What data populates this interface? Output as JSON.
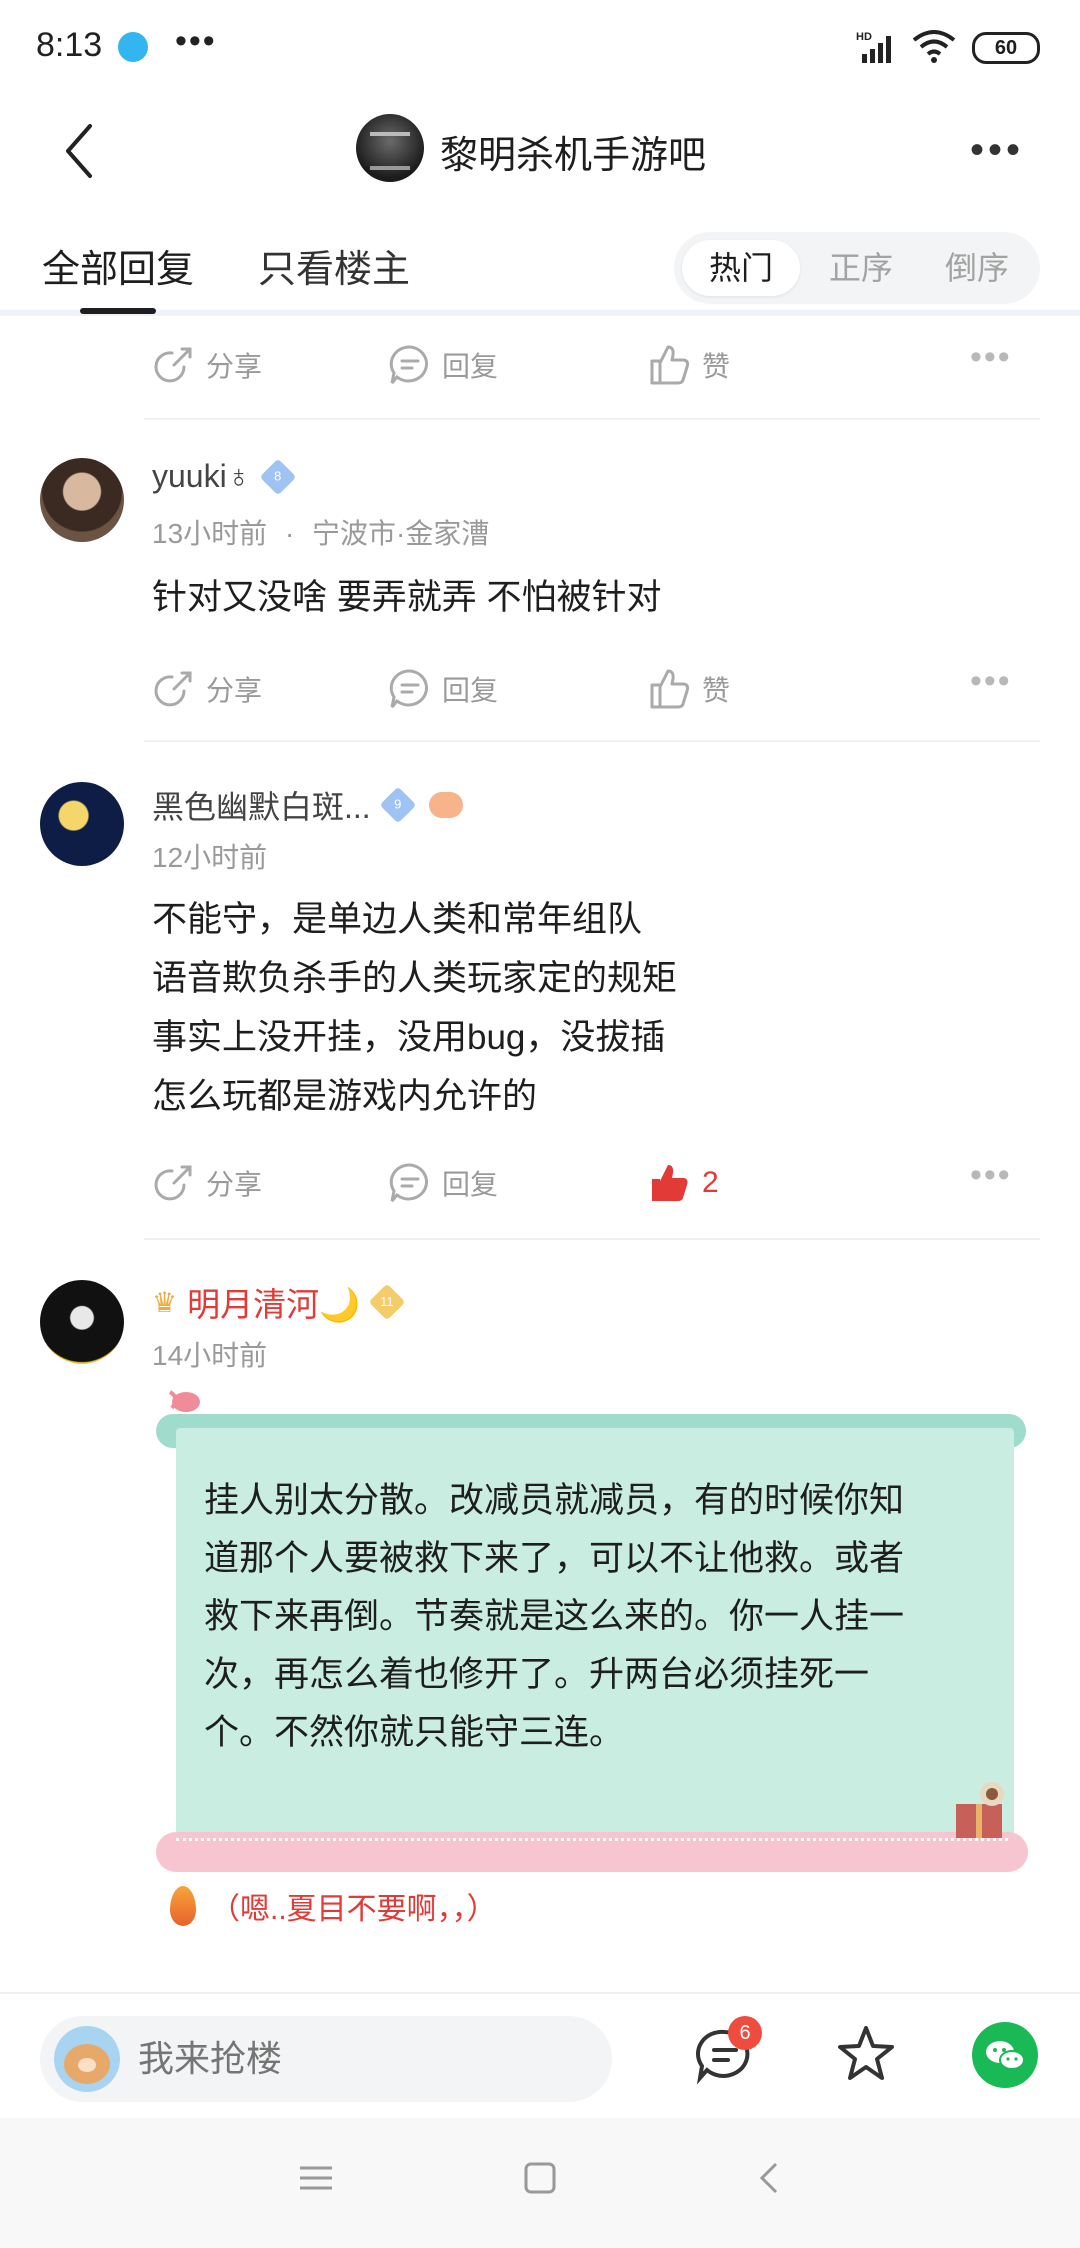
{
  "status_bar": {
    "time": "8:13",
    "hd_label": "HD",
    "battery": "60",
    "icons": [
      "app-notification-icon",
      "more-dots-icon",
      "signal-icon",
      "wifi-icon",
      "battery-icon"
    ]
  },
  "nav": {
    "title": "黎明杀机手游吧",
    "icons": [
      "back-icon",
      "forum-avatar",
      "more-menu-icon"
    ]
  },
  "tabs": {
    "all": "全部回复",
    "op_only": "只看楼主",
    "sort_options": [
      "热门",
      "正序",
      "倒序"
    ],
    "active_sort": "热门"
  },
  "actions": {
    "share": "分享",
    "reply": "回复",
    "like": "赞"
  },
  "posts": [
    {
      "username": "yuuki♁",
      "level": "8",
      "time": "13小时前",
      "location": "宁波市·金家漕",
      "lines": [
        "针对又没啥 要弄就弄 不怕被针对"
      ],
      "likes": ""
    },
    {
      "username": "黑色幽默白斑...",
      "level": "9",
      "time": "12小时前",
      "lines": [
        "不能守，是单边人类和常年组队",
        "语音欺负杀手的人类玩家定的规矩",
        "事实上没开挂，没用bug，没拔插",
        "怎么玩都是游戏内允许的"
      ],
      "likes": "2"
    },
    {
      "username": "明月清河🌙",
      "level": "11",
      "time": "14小时前",
      "bubble_text": "挂人别太分散。改减员就减员，有的时候你知\n道那个人要被救下来了，可以不让他救。或者\n救下来再倒。节奏就是这么来的。你一人挂一\n次，再怎么着也修开了。升两台必须挂死一\n个。不然你就只能守三连。",
      "tail": "（嗯..夏目不要啊，，）"
    }
  ],
  "bottom_bar": {
    "placeholder": "我来抢楼",
    "comment_badge": "6"
  },
  "colors": {
    "like_active": "#e23a37",
    "vip_name": "#e23a37",
    "bubble_bg": "#c9ede1",
    "wechat": "#19b955"
  }
}
